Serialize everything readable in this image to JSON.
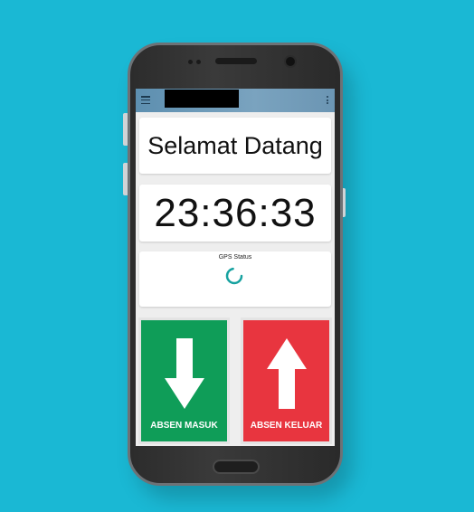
{
  "app_bar": {
    "menu_icon": "menu-icon",
    "overflow_icon": "overflow-menu-icon",
    "title": ""
  },
  "welcome": {
    "text": "Selamat Datang"
  },
  "clock": {
    "time": "23:36:33"
  },
  "gps": {
    "label": "GPS Status",
    "indicator": "loading-spinner-icon",
    "color": "#17a2a0"
  },
  "actions": {
    "check_in": {
      "label": "ABSEN MASUK",
      "icon": "arrow-down-icon",
      "color": "#0f9d58"
    },
    "check_out": {
      "label": "ABSEN KELUAR",
      "icon": "arrow-up-icon",
      "color": "#e8353f"
    }
  },
  "background_color": "#1ab8d4"
}
